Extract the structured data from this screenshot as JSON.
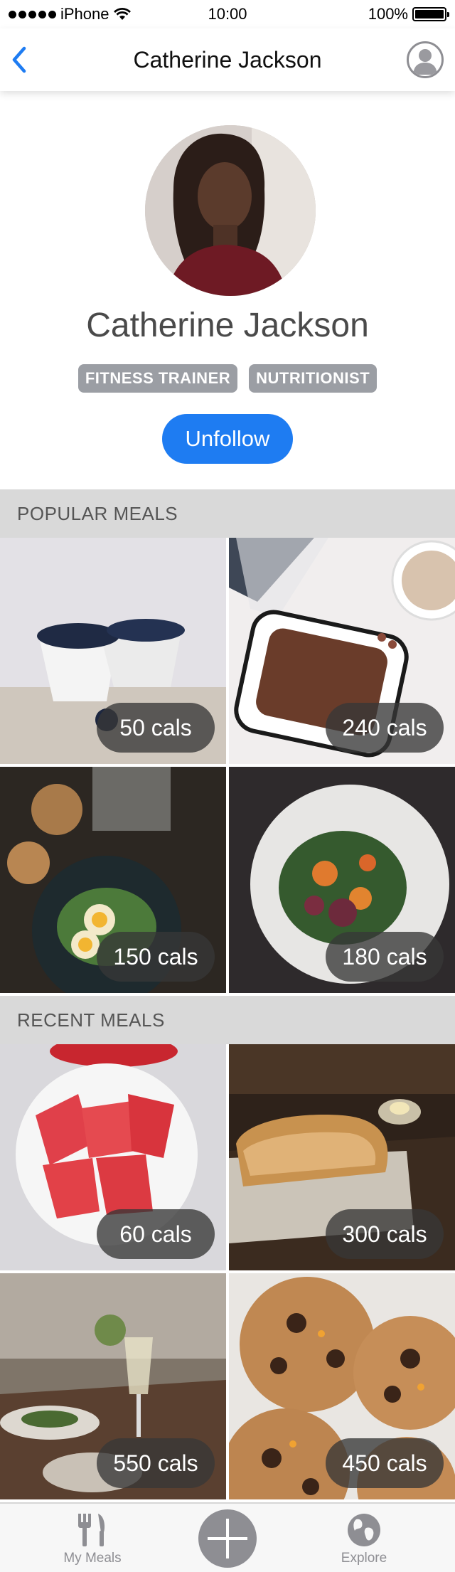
{
  "status_bar": {
    "carrier": "iPhone",
    "time": "10:00",
    "battery": "100%"
  },
  "nav": {
    "title": "Catherine Jackson",
    "back_icon": "chevron-left-icon",
    "profile_icon": "user-avatar-icon"
  },
  "profile": {
    "name": "Catherine Jackson",
    "tags": [
      "FITNESS TRAINER",
      "NUTRITIONIST"
    ],
    "follow_button": "Unfollow"
  },
  "sections": {
    "popular": {
      "title": "POPULAR MEALS",
      "meals": [
        {
          "cals": "50 cals"
        },
        {
          "cals": "240 cals"
        },
        {
          "cals": "150 cals"
        },
        {
          "cals": "180 cals"
        }
      ]
    },
    "recent": {
      "title": "RECENT MEALS",
      "meals": [
        {
          "cals": "60 cals"
        },
        {
          "cals": "300 cals"
        },
        {
          "cals": "550 cals"
        },
        {
          "cals": "450 cals"
        }
      ]
    }
  },
  "tabbar": {
    "my_meals": "My Meals",
    "explore": "Explore",
    "add_icon": "plus-icon"
  },
  "colors": {
    "accent": "#1e7cf2",
    "tag_bg": "#9b9ea4",
    "section_bg": "#d9d9d9",
    "tab_icon": "#8e8e93"
  }
}
